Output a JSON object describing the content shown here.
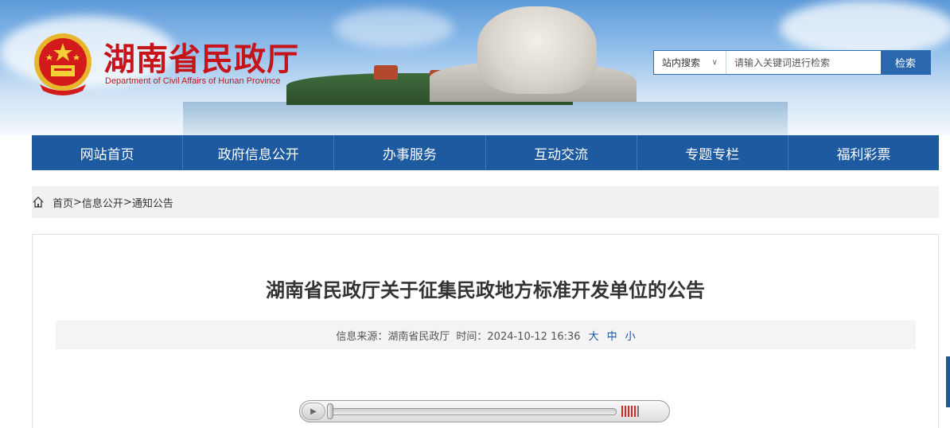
{
  "header": {
    "title": "湖南省民政厅",
    "subtitle": "Department of Civil Affairs of Hunan Province",
    "emblem_icon": "national-emblem-icon"
  },
  "search": {
    "scope_label": "站内搜索",
    "placeholder": "请输入关键词进行检索",
    "button_label": "检索"
  },
  "nav": {
    "items": [
      {
        "label": "网站首页"
      },
      {
        "label": "政府信息公开"
      },
      {
        "label": "办事服务"
      },
      {
        "label": "互动交流"
      },
      {
        "label": "专题专栏"
      },
      {
        "label": "福利彩票"
      }
    ]
  },
  "breadcrumb": {
    "home": "首页",
    "sep": ">",
    "level1": "信息公开",
    "level2": "通知公告"
  },
  "article": {
    "title": "湖南省民政厅关于征集民政地方标准开发单位的公告",
    "source": "信息来源：湖南省民政厅",
    "time": "时间：2024-10-12 16:36",
    "font_large": "大",
    "font_medium": "中",
    "font_small": "小"
  },
  "colors": {
    "brand_red": "#c6141b",
    "nav_blue": "#1e5aa0"
  }
}
